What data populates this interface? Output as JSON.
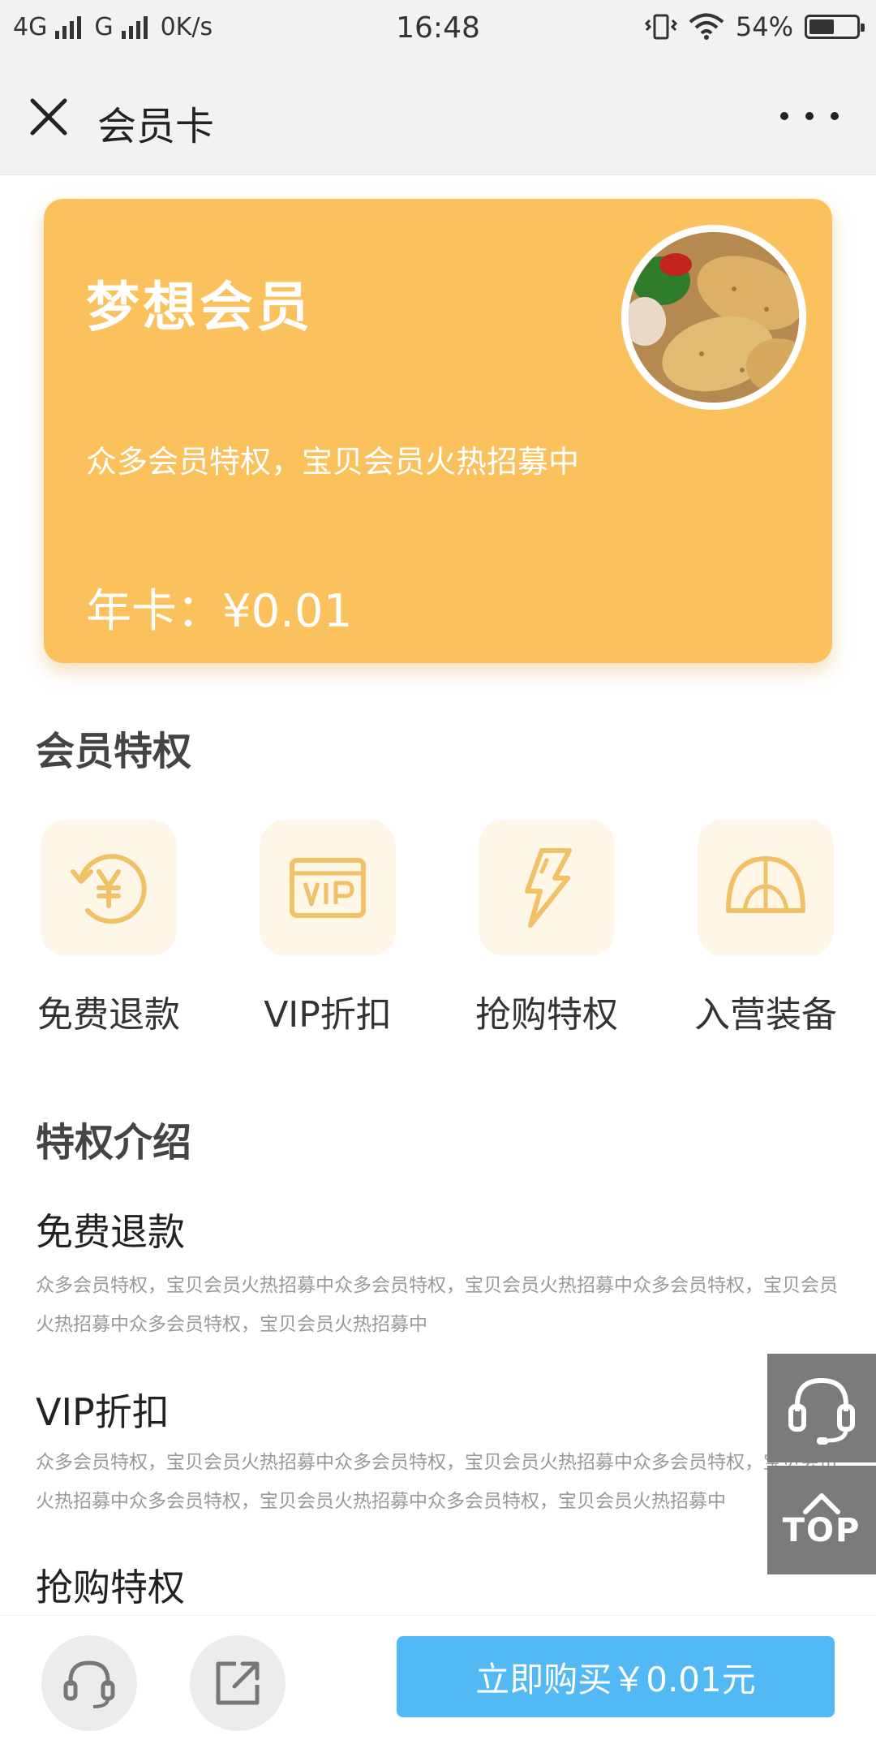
{
  "status_bar": {
    "network1": "4G",
    "network2": "G",
    "speed": "0K/s",
    "time": "16:48",
    "battery_text": "54%",
    "battery_level": 0.54
  },
  "nav": {
    "title": "会员卡",
    "close_icon": "close-icon",
    "more_icon": "more-icon"
  },
  "card": {
    "title": "梦想会员",
    "description": "众多会员特权，宝贝会员火热招募中",
    "price": "年卡：¥0.01",
    "background_color": "#fbc15d"
  },
  "privileges": {
    "title": "会员特权",
    "items": [
      {
        "label": "免费退款",
        "icon": "refund-icon"
      },
      {
        "label": "VIP折扣",
        "icon": "vip-icon"
      },
      {
        "label": "抢购特权",
        "icon": "lightning-icon"
      },
      {
        "label": "入营装备",
        "icon": "tent-icon"
      }
    ]
  },
  "intro": {
    "title": "特权介绍",
    "items": [
      {
        "heading": "免费退款",
        "text": "众多会员特权，宝贝会员火热招募中众多会员特权，宝贝会员火热招募中众多会员特权，宝贝会员火热招募中众多会员特权，宝贝会员火热招募中"
      },
      {
        "heading": "VIP折扣",
        "text": "众多会员特权，宝贝会员火热招募中众多会员特权，宝贝会员火热招募中众多会员特权，宝贝会员火热招募中众多会员特权，宝贝会员火热招募中众多会员特权，宝贝会员火热招募中"
      },
      {
        "heading": "抢购特权",
        "text": ""
      }
    ]
  },
  "floating": {
    "customer_service_icon": "headset-icon",
    "top_label": "TOP"
  },
  "bottom_bar": {
    "service_icon": "headset-icon",
    "share_icon": "share-icon",
    "buy_label": "立即购买￥0.01元",
    "buy_color": "#52b9f5"
  }
}
